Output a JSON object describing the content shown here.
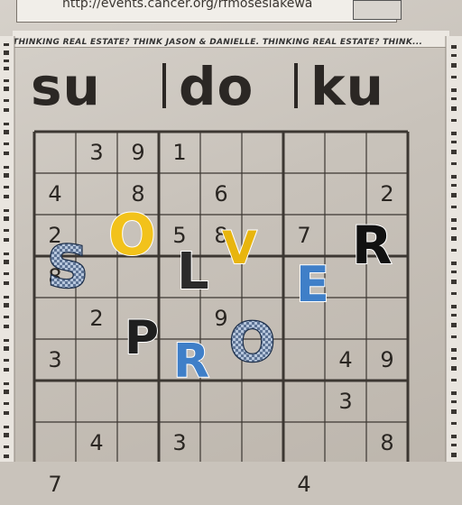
{
  "header": {
    "url_text": "http://events.cancer.org/rfmoseslakewa"
  },
  "ticker": {
    "text": "THINKING REAL ESTATE? THINK JASON & DANIELLE. THINKING REAL ESTATE? THINK..."
  },
  "title": {
    "words": [
      "su",
      "do",
      "ku"
    ]
  },
  "puzzle": {
    "rows": [
      [
        "",
        "3",
        "9",
        "1",
        "",
        "",
        "",
        "",
        ""
      ],
      [
        "4",
        "",
        "8",
        "",
        "6",
        "",
        "",
        "",
        "2"
      ],
      [
        "2",
        "",
        "",
        "5",
        "8",
        "",
        "7",
        "",
        ""
      ],
      [
        "8",
        "",
        "",
        "",
        "",
        "",
        "",
        "",
        ""
      ],
      [
        "",
        "2",
        "",
        "",
        "9",
        "",
        "",
        "",
        ""
      ],
      [
        "3",
        "",
        "",
        "",
        "",
        "",
        "",
        "4",
        "9"
      ],
      [
        "",
        "",
        "",
        "",
        "",
        "",
        "",
        "3",
        ""
      ],
      [
        "",
        "4",
        "",
        "3",
        "",
        "",
        "",
        "",
        "8"
      ],
      [
        "7",
        "",
        "",
        "",
        "",
        "",
        "4",
        "",
        ""
      ]
    ]
  },
  "overlay": {
    "letters": [
      {
        "char": "S",
        "color": "#8fa8c8",
        "stroke": "#1d2f4a"
      },
      {
        "char": "O",
        "color": "#f2c21b",
        "stroke": "#ffffff"
      },
      {
        "char": "L",
        "color": "#2b2b2b",
        "stroke": "#ffffff"
      },
      {
        "char": "V",
        "color": "#e8b50e",
        "stroke": "#ffffff"
      },
      {
        "char": "E",
        "color": "#3f7fc8",
        "stroke": "#ffffff"
      },
      {
        "char": "R",
        "color": "#111111",
        "stroke": "#ffffff"
      },
      {
        "char": "P",
        "color": "#1f1f1f",
        "stroke": "#ffffff"
      },
      {
        "char": "R",
        "color": "#3f7fc8",
        "stroke": "#ffffff"
      },
      {
        "char": "O",
        "color": "#8fa8c8",
        "stroke": "#1d2f4a"
      }
    ]
  }
}
